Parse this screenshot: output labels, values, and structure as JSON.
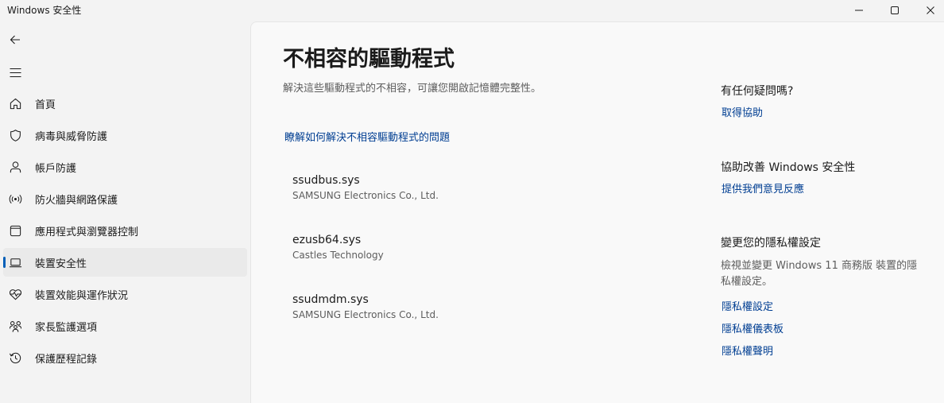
{
  "titlebar": {
    "title": "Windows 安全性",
    "minimize_icon": "minimize-icon",
    "maximize_icon": "maximize-icon",
    "close_icon": "close-icon"
  },
  "navigation": {
    "back_icon": "back-arrow-icon",
    "menu_icon": "hamburger-menu-icon",
    "items": [
      {
        "label": "首頁",
        "icon": "home-icon",
        "active": false
      },
      {
        "label": "病毒與威脅防護",
        "icon": "shield-icon",
        "active": false
      },
      {
        "label": "帳戶防護",
        "icon": "person-icon",
        "active": false
      },
      {
        "label": "防火牆與網路保護",
        "icon": "wireless-icon",
        "active": false
      },
      {
        "label": "應用程式與瀏覽器控制",
        "icon": "app-window-icon",
        "active": false
      },
      {
        "label": "裝置安全性",
        "icon": "laptop-icon",
        "active": true
      },
      {
        "label": "裝置效能與運作狀況",
        "icon": "heart-pulse-icon",
        "active": false
      },
      {
        "label": "家長監護選項",
        "icon": "family-icon",
        "active": false
      },
      {
        "label": "保護歷程記錄",
        "icon": "history-icon",
        "active": false
      }
    ]
  },
  "main": {
    "title": "不相容的驅動程式",
    "description": "解決這些驅動程式的不相容，可讓您開啟記憶體完整性。",
    "learn_link": "瞭解如何解決不相容驅動程式的問題",
    "drivers": [
      {
        "name": "ssudbus.sys",
        "vendor": "SAMSUNG Electronics Co., Ltd."
      },
      {
        "name": "ezusb64.sys",
        "vendor": "Castles Technology"
      },
      {
        "name": "ssudmdm.sys",
        "vendor": "SAMSUNG Electronics Co., Ltd."
      }
    ]
  },
  "side": {
    "help_title": "有任何疑問嗎?",
    "help_link": "取得協助",
    "improve_title": "協助改善 Windows 安全性",
    "feedback_link": "提供我們意見反應",
    "privacy_title": "變更您的隱私權設定",
    "privacy_text": "檢視並變更 Windows 11 商務版 裝置的隱私權設定。",
    "privacy_links": [
      "隱私權設定",
      "隱私權儀表板",
      "隱私權聲明"
    ]
  },
  "colors": {
    "accent": "#005fb8",
    "link": "#003e92",
    "background": "#f3f3f3",
    "content_background": "#f9f9f9"
  }
}
